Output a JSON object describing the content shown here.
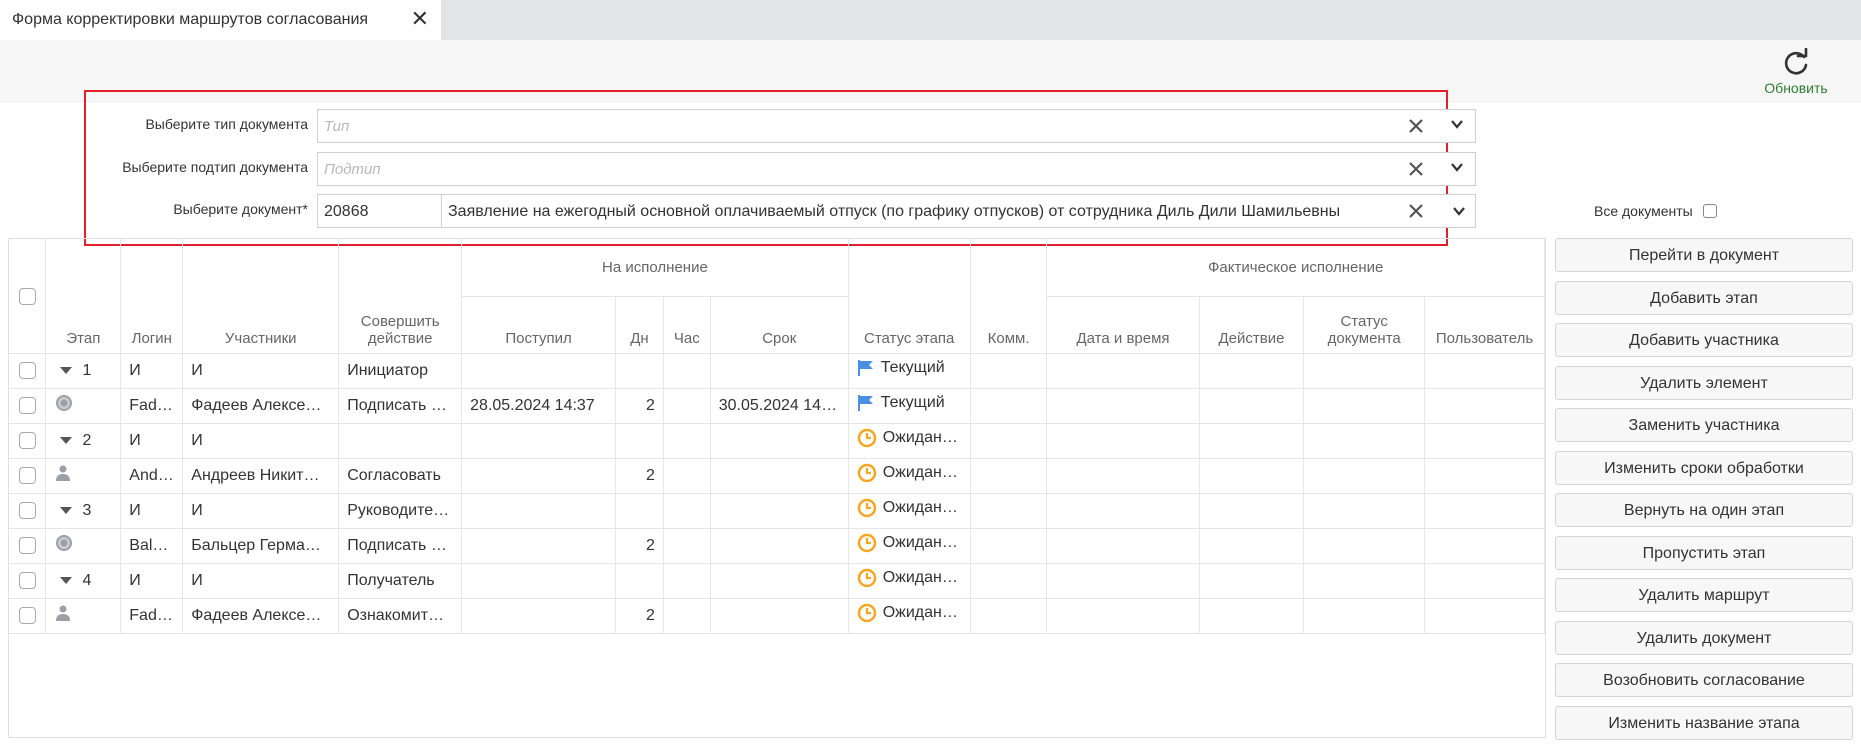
{
  "tab": {
    "title": "Форма корректировки маршрутов согласования"
  },
  "toolbar": {
    "refresh_label": "Обновить"
  },
  "filters": {
    "doc_type_label": "Выберите тип документа",
    "doc_type_placeholder": "Тип",
    "doc_subtype_label": "Выберите подтип документа",
    "doc_subtype_placeholder": "Подтип",
    "document_label": "Выберите документ*",
    "document_number": "20868",
    "document_title": "Заявление на ежегодный основной оплачиваемый отпуск (по графику отпусков) от сотрудника Диль Дили Шамильевны"
  },
  "all_docs_label": "Все документы",
  "grid": {
    "group_headers": {
      "execution": "На исполнение",
      "actual": "Фактическое исполнение"
    },
    "columns": {
      "stage": "Этап",
      "login": "Логин",
      "participants": "Участники",
      "action": "Совершить действие",
      "received": "Поступил",
      "days": "Дн",
      "hours": "Час",
      "deadline": "Срок",
      "stage_status": "Статус этапа",
      "comment": "Комм.",
      "datetime": "Дата и время",
      "actual_action": "Действие",
      "doc_status": "Статус документа",
      "user": "Пользователь"
    },
    "rows": [
      {
        "icon": "expand",
        "stage": "1",
        "login": "И",
        "participant": "И",
        "action": "Инициатор",
        "received": "",
        "days": "",
        "hours": "",
        "deadline": "",
        "status_icon": "flag",
        "status": "Текущий"
      },
      {
        "icon": "group",
        "stage": "",
        "login": "Fad…",
        "participant": "Фадеев Алексе…",
        "action": "Подписать …",
        "received": "28.05.2024 14:37",
        "days": "2",
        "hours": "",
        "deadline": "30.05.2024 14…",
        "status_icon": "flag",
        "status": "Текущий"
      },
      {
        "icon": "expand",
        "stage": "2",
        "login": "И",
        "participant": "И",
        "action": "",
        "received": "",
        "days": "",
        "hours": "",
        "deadline": "",
        "status_icon": "clock",
        "status": "Ожидан…"
      },
      {
        "icon": "user",
        "stage": "",
        "login": "And…",
        "participant": "Андреев Никит…",
        "action": "Согласовать",
        "received": "",
        "days": "2",
        "hours": "",
        "deadline": "",
        "status_icon": "clock",
        "status": "Ожидан…"
      },
      {
        "icon": "expand",
        "stage": "3",
        "login": "И",
        "participant": "И",
        "action": "Руководите…",
        "received": "",
        "days": "",
        "hours": "",
        "deadline": "",
        "status_icon": "clock",
        "status": "Ожидан…"
      },
      {
        "icon": "group",
        "stage": "",
        "login": "Bal…",
        "participant": "Бальцер Герма…",
        "action": "Подписать …",
        "received": "",
        "days": "2",
        "hours": "",
        "deadline": "",
        "status_icon": "clock",
        "status": "Ожидан…"
      },
      {
        "icon": "expand",
        "stage": "4",
        "login": "И",
        "participant": "И",
        "action": "Получатель",
        "received": "",
        "days": "",
        "hours": "",
        "deadline": "",
        "status_icon": "clock",
        "status": "Ожидан…"
      },
      {
        "icon": "user",
        "stage": "",
        "login": "Fad…",
        "participant": "Фадеев Алексе…",
        "action": "Ознакомит…",
        "received": "",
        "days": "2",
        "hours": "",
        "deadline": "",
        "status_icon": "clock",
        "status": "Ожидан…"
      }
    ]
  },
  "actions": [
    "Перейти в документ",
    "Добавить этап",
    "Добавить участника",
    "Удалить элемент",
    "Заменить участника",
    "Изменить сроки обработки",
    "Вернуть на один этап",
    "Пропустить этап",
    "Удалить маршрут",
    "Удалить документ",
    "Возобновить согласование",
    "Изменить название этапа"
  ],
  "colors": {
    "accent_green": "#2e7d32",
    "highlight_red": "#e0202a",
    "flag_blue": "#4a90e2",
    "clock_orange": "#f5a623"
  }
}
